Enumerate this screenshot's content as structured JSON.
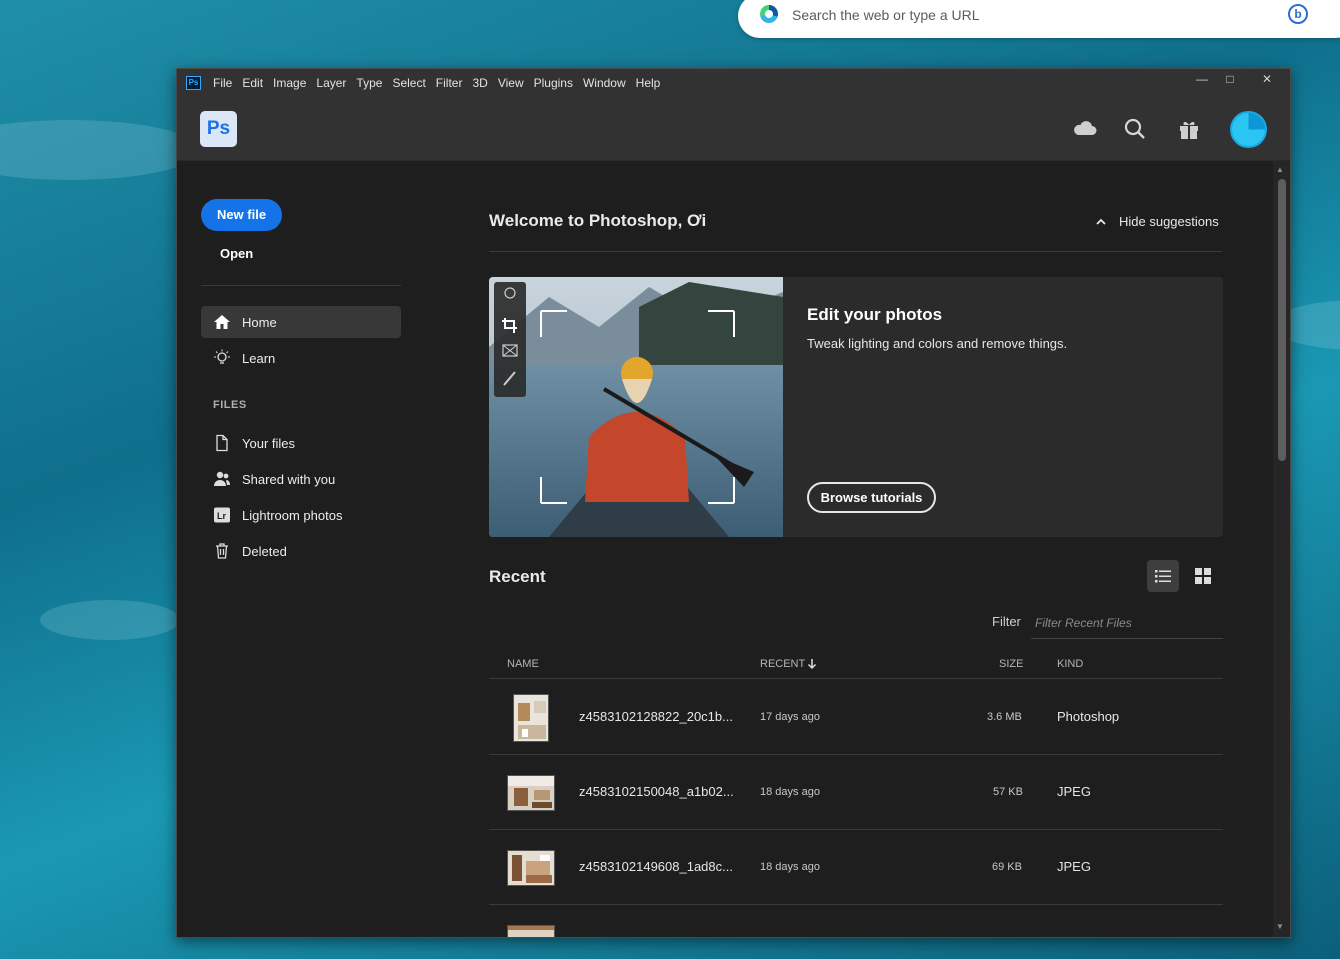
{
  "browser": {
    "search_placeholder": "Search the web or type a URL",
    "bing_label": "b"
  },
  "menubar": {
    "app_badge": "Ps",
    "items": [
      "File",
      "Edit",
      "Image",
      "Layer",
      "Type",
      "Select",
      "Filter",
      "3D",
      "View",
      "Plugins",
      "Window",
      "Help"
    ],
    "minimize": "—",
    "maximize": "□",
    "close": "✕"
  },
  "appbar": {
    "logo": "Ps",
    "icons": [
      "cloud-icon",
      "search-icon",
      "gift-icon",
      "avatar"
    ]
  },
  "sidebar": {
    "new_file": "New file",
    "open": "Open",
    "nav": [
      {
        "label": "Home",
        "icon": "home-icon"
      },
      {
        "label": "Learn",
        "icon": "lightbulb-icon"
      }
    ],
    "files_heading": "FILES",
    "files": [
      {
        "label": "Your files",
        "icon": "document-icon"
      },
      {
        "label": "Shared with you",
        "icon": "users-icon"
      },
      {
        "label": "Lightroom photos",
        "icon": "lightroom-icon"
      },
      {
        "label": "Deleted",
        "icon": "trash-icon"
      }
    ]
  },
  "main": {
    "welcome": "Welcome to Photoshop, Ơi",
    "hide_suggestions": "Hide suggestions",
    "card": {
      "title": "Edit your photos",
      "subtitle": "Tweak lighting and colors and remove things.",
      "button": "Browse tutorials"
    },
    "recent_title": "Recent",
    "filter_label": "Filter",
    "filter_placeholder": "Filter Recent Files",
    "columns": {
      "name": "NAME",
      "recent": "RECENT",
      "size": "SIZE",
      "kind": "KIND"
    },
    "files": [
      {
        "name": "z4583102128822_20c1b...",
        "recent": "17 days ago",
        "size": "3.6 MB",
        "kind": "Photoshop"
      },
      {
        "name": "z4583102150048_a1b02...",
        "recent": "18 days ago",
        "size": "57 KB",
        "kind": "JPEG"
      },
      {
        "name": "z4583102149608_1ad8c...",
        "recent": "18 days ago",
        "size": "69 KB",
        "kind": "JPEG"
      }
    ]
  },
  "colors": {
    "accent": "#1473e6",
    "ps_blue": "#31a8ff",
    "panel": "#1e1e1e",
    "bar": "#323232"
  }
}
